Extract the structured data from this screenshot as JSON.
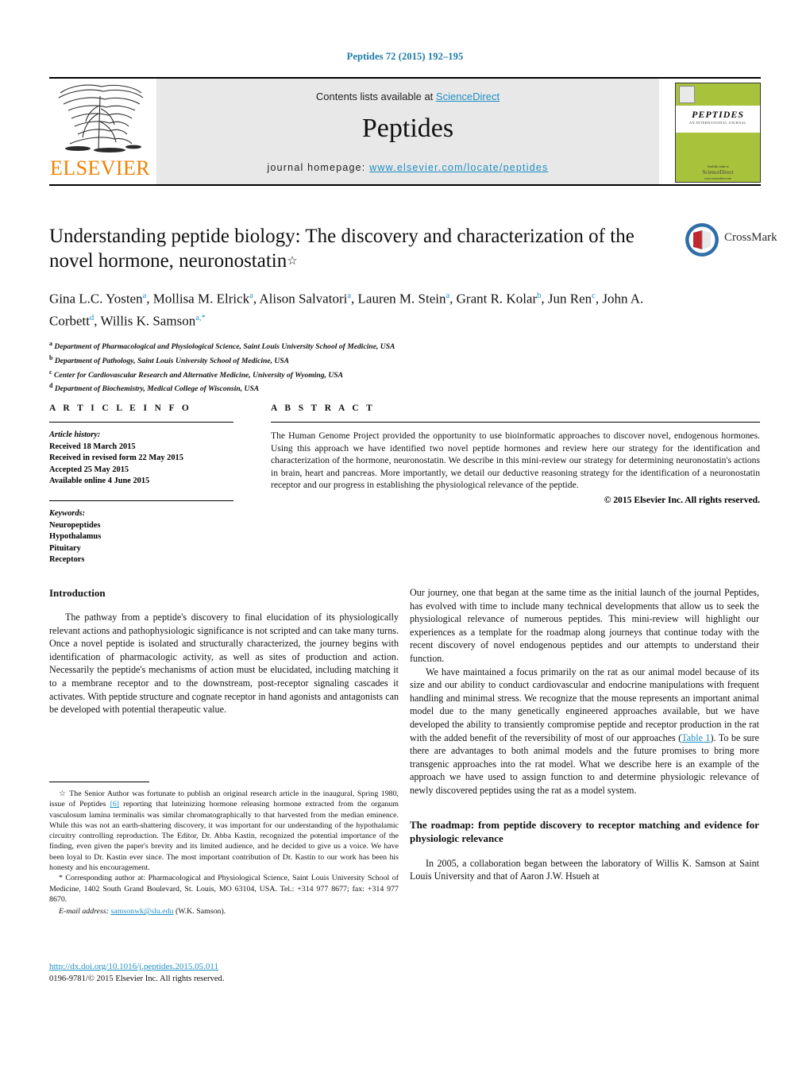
{
  "running_head": "Peptides 72 (2015) 192–195",
  "masthead": {
    "contents_prefix": "Contents lists available at ",
    "sciencedirect": "ScienceDirect",
    "journal_name": "Peptides",
    "homepage_prefix": "journal homepage: ",
    "homepage_url": "www.elsevier.com/locate/peptides",
    "publisher": "ELSEVIER",
    "cover": {
      "title": "PEPTIDES",
      "subtitle": "AN INTERNATIONAL JOURNAL",
      "foot_small": "Available online at",
      "foot_brand": "ScienceDirect",
      "foot_tiny": "www.sciencedirect.com"
    }
  },
  "article": {
    "title": "Understanding peptide biology: The discovery and characterization of the novel hormone, neuronostatin",
    "title_marker": "☆",
    "crossmark_label": "CrossMark",
    "authors": [
      {
        "name": "Gina L.C. Yosten",
        "sup": "a",
        "sep": ", "
      },
      {
        "name": "Mollisa M. Elrick",
        "sup": "a",
        "sep": ", "
      },
      {
        "name": "Alison Salvatori",
        "sup": "a",
        "sep": ", "
      },
      {
        "name": "Lauren M. Stein",
        "sup": "a",
        "sep": ", "
      },
      {
        "name": "Grant R. Kolar",
        "sup": "b",
        "sep": ", "
      },
      {
        "name": "Jun Ren",
        "sup": "c",
        "sep": ", "
      },
      {
        "name": "John A. Corbett",
        "sup": "d",
        "sep": ", "
      },
      {
        "name": "Willis K. Samson",
        "sup": "a,*",
        "sep": ""
      }
    ],
    "affiliations": [
      {
        "mark": "a",
        "text": "Department of Pharmacological and Physiological Science, Saint Louis University School of Medicine, USA"
      },
      {
        "mark": "b",
        "text": "Department of Pathology, Saint Louis University School of Medicine, USA"
      },
      {
        "mark": "c",
        "text": "Center for Cardiovascular Research and Alternative Medicine, University of Wyoming, USA"
      },
      {
        "mark": "d",
        "text": "Department of Biochemistry, Medical College of Wisconsin, USA"
      }
    ]
  },
  "article_info": {
    "heading": "A R T I C L E   I N F O",
    "history_label": "Article history:",
    "history": [
      "Received 18 March 2015",
      "Received in revised form 22 May 2015",
      "Accepted 25 May 2015",
      "Available online 4 June 2015"
    ],
    "keywords_label": "Keywords:",
    "keywords": [
      "Neuropeptides",
      "Hypothalamus",
      "Pituitary",
      "Receptors"
    ]
  },
  "abstract": {
    "heading": "A B S T R A C T",
    "text": "The Human Genome Project provided the opportunity to use bioinformatic approaches to discover novel, endogenous hormones. Using this approach we have identified two novel peptide hormones and review here our strategy for the identification and characterization of the hormone, neuronostatin. We describe in this mini-review our strategy for determining neuronostatin's actions in brain, heart and pancreas. More importantly, we detail our deductive reasoning strategy for the identification of a neuronostatin receptor and our progress in establishing the physiological relevance of the peptide.",
    "copyright": "© 2015 Elsevier Inc. All rights reserved."
  },
  "body": {
    "intro_heading": "Introduction",
    "intro_p1": "The pathway from a peptide's discovery to final elucidation of its physiologically relevant actions and pathophysiologic significance is not scripted and can take many turns. Once a novel peptide is isolated and structurally characterized, the journey begins with identification of pharmacologic activity, as well as sites of production and action. Necessarily the peptide's mechanisms of action must be elucidated, including matching it to a membrane receptor and to the downstream, post-receptor signaling cascades it activates. With peptide structure and cognate receptor in hand agonists and antagonists can be developed with potential therapeutic value.",
    "right_p1": "Our journey, one that began at the same time as the initial launch of the journal Peptides, has evolved with time to include many technical developments that allow us to seek the physiological relevance of numerous peptides. This mini-review will highlight our experiences as a template for the roadmap along journeys that continue today with the recent discovery of novel endogenous peptides and our attempts to understand their function.",
    "right_p2_a": "We have maintained a focus primarily on the rat as our animal model because of its size and our ability to conduct cardiovascular and endocrine manipulations with frequent handling and minimal stress. We recognize that the mouse represents an important animal model due to the many genetically engineered approaches available, but we have developed the ability to transiently compromise peptide and receptor production in the rat with the added benefit of the reversibility of most of our approaches (",
    "right_p2_link": "Table 1",
    "right_p2_b": "). To be sure there are advantages to both animal models and the future promises to bring more transgenic approaches into the rat model. What we describe here is an example of the approach we have used to assign function to and determine physiologic relevance of newly discovered peptides using the rat as a model system.",
    "roadmap_heading": "The roadmap: from peptide discovery to receptor matching and evidence for physiologic relevance",
    "roadmap_p1": "In 2005, a collaboration began between the laboratory of Willis K. Samson at Saint Louis University and that of Aaron J.W. Hsueh at"
  },
  "footnotes": {
    "star_marker": "☆",
    "star_a": " The Senior Author was fortunate to publish an original research article in the inaugural, Spring 1980, issue of Peptides ",
    "star_ref": "[6]",
    "star_b": " reporting that luteinizing hormone releasing hormone extracted from the organum vasculosum lamina terminalis was similar chromatographically to that harvested from the median eminence. While this was not an earth-shattering discovery, it was important for our understanding of the hypothalamic circuitry controlling reproduction. The Editor, Dr. Abba Kastin, recognized the potential importance of the finding, even given the paper's brevity and its limited audience, and he decided to give us a voice. We have been loyal to Dr. Kastin ever since. The most important contribution of Dr. Kastin to our work has been his honesty and his encouragement.",
    "corr_marker": "*",
    "corr_text": " Corresponding author at: Pharmacological and Physiological Science, Saint Louis University School of Medicine, 1402 South Grand Boulevard, St. Louis, MO 63104, USA. Tel.: +314 977 8677; fax: +314 977 8670.",
    "email_label": "E-mail address:",
    "email": "samsonwk@slu.edu",
    "email_suffix": " (W.K. Samson)."
  },
  "footer": {
    "doi": "http://dx.doi.org/10.1016/j.peptides.2015.05.011",
    "issn": "0196-9781/© 2015 Elsevier Inc. All rights reserved."
  },
  "colors": {
    "link": "#1f8fc4",
    "elsevier_orange": "#ef8200",
    "cover_green": "#a8c23c"
  }
}
